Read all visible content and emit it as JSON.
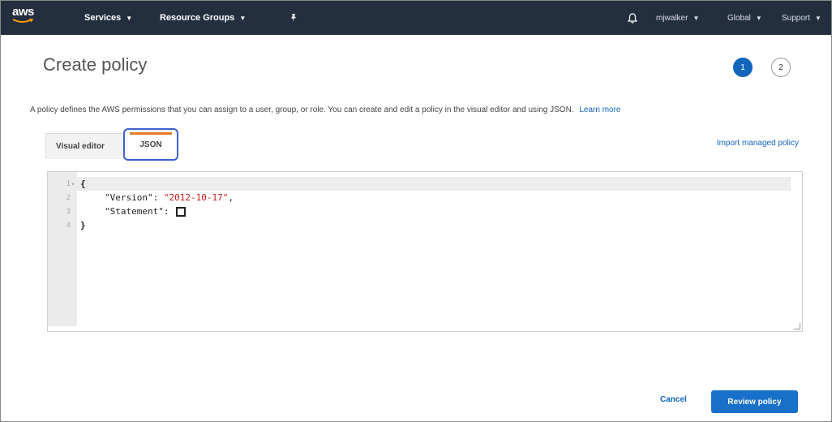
{
  "nav": {
    "logo": "aws",
    "services": "Services",
    "resource_groups": "Resource Groups",
    "user": "mjwalker",
    "region": "Global",
    "support": "Support"
  },
  "page": {
    "title": "Create policy",
    "steps": [
      "1",
      "2"
    ],
    "description": "A policy defines the AWS permissions that you can assign to a user, group, or role. You can create and edit a policy in the visual editor and using JSON.",
    "learn_more": "Learn more"
  },
  "tabs": {
    "visual_editor": "Visual editor",
    "json": "JSON",
    "import_link": "Import managed policy"
  },
  "editor": {
    "line_numbers": [
      "1",
      "2",
      "3",
      "4"
    ],
    "lines": {
      "l1": "{",
      "version_key": "\"Version\": ",
      "version_value": "\"2012-10-17\"",
      "version_comma": ",",
      "statement_key": "\"Statement\": ",
      "l4": "}"
    }
  },
  "footer": {
    "cancel": "Cancel",
    "review": "Review policy"
  },
  "colors": {
    "nav_bg": "#232f3e",
    "primary": "#1870c8",
    "link": "#1166bb",
    "tab_highlight": "#3b5fd0",
    "tab_accent": "#e07b2a",
    "string": "#c41a16"
  }
}
